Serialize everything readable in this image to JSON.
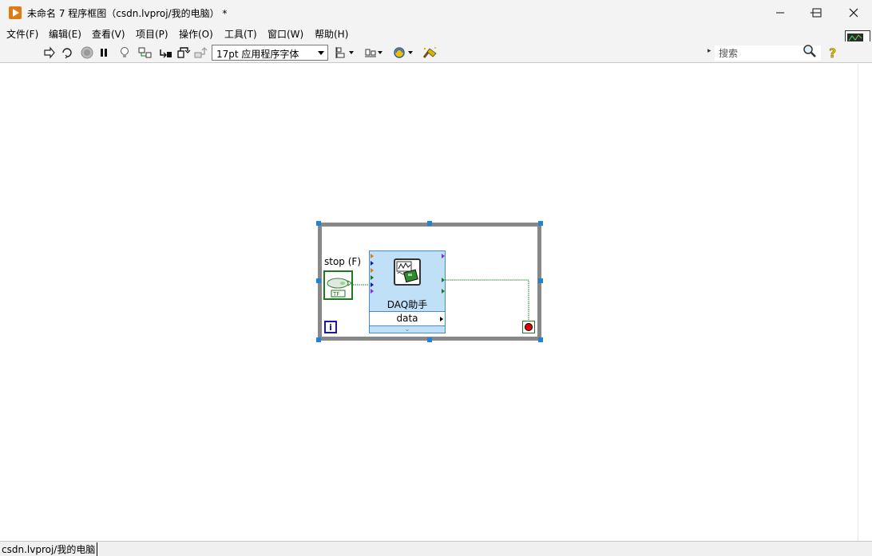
{
  "window": {
    "title": "未命名 7 程序框图（csdn.lvproj/我的电脑） *",
    "controls": {
      "minimize": "—",
      "maximize": "☐",
      "close": "✕"
    }
  },
  "menu": {
    "items": [
      "文件(F)",
      "编辑(E)",
      "查看(V)",
      "项目(P)",
      "操作(O)",
      "工具(T)",
      "窗口(W)",
      "帮助(H)"
    ]
  },
  "toolbar": {
    "font_select": "17pt 应用程序字体",
    "search_placeholder": "搜索",
    "icons": [
      "run-arrow-icon",
      "run-continuously-icon",
      "abort-icon",
      "pause-icon",
      "highlight-execution-icon",
      "retain-wire-values-icon",
      "step-into-icon",
      "step-over-icon",
      "step-out-icon",
      "align-objects-icon",
      "distribute-objects-icon",
      "reorder-icon",
      "cleanup-diagram-icon",
      "search-icon",
      "context-help-icon"
    ]
  },
  "diagram": {
    "stop_control_label": "stop (F)",
    "bool_indicator_text": "TF",
    "iteration_terminal": "i",
    "express_vi_name": "DAQ助手",
    "express_vi_output": "data",
    "colors": {
      "loop_border": "#888888",
      "selection_handle": "#1f84d8",
      "express_bg": "#bfe0f7",
      "bool_wire": "#1f7a1f",
      "stop_red": "#e00000"
    }
  },
  "status": {
    "path": "csdn.lvproj/我的电脑"
  }
}
